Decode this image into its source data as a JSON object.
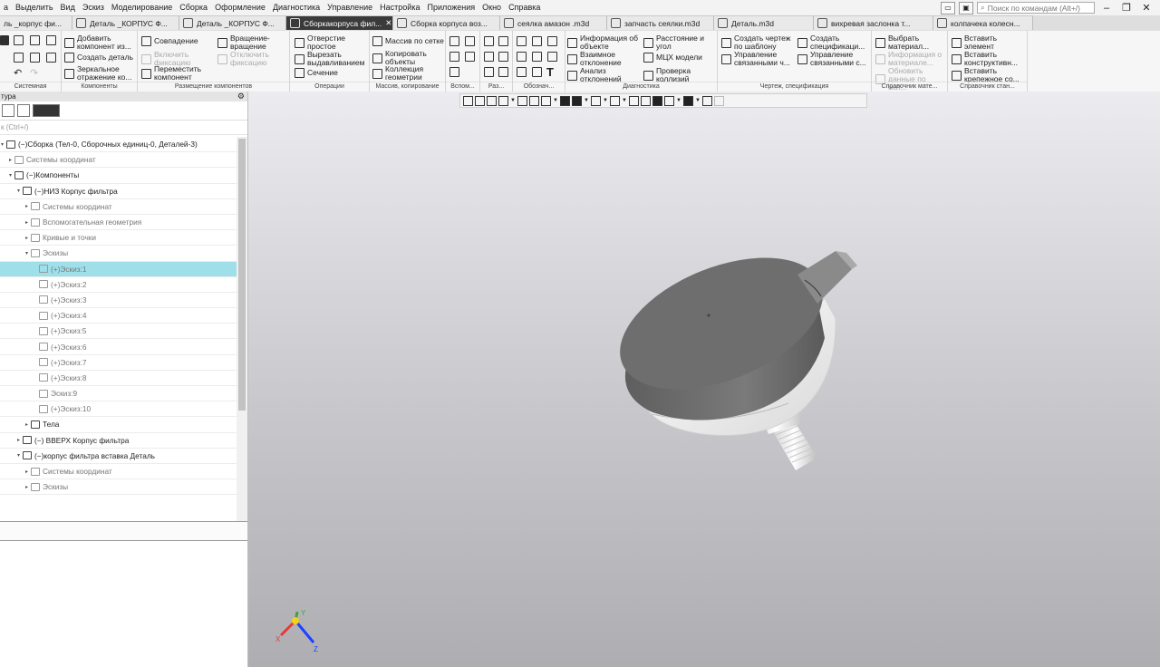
{
  "menubar": {
    "items": [
      "а",
      "Выделить",
      "Вид",
      "Эскиз",
      "Моделирование",
      "Сборка",
      "Оформление",
      "Диагностика",
      "Управление",
      "Настройка",
      "Приложения",
      "Окно",
      "Справка"
    ],
    "search_placeholder": "Поиск по командам (Alt+/)"
  },
  "tabs": [
    {
      "label": "ль _корпус фи...",
      "active": false
    },
    {
      "label": "Деталь _КОРПУС Ф...",
      "active": false
    },
    {
      "label": "Деталь _КОРПУС Ф...",
      "active": false
    },
    {
      "label": "Сборкакорпуса фил...",
      "active": true
    },
    {
      "label": "Сборка корпуса воз...",
      "active": false
    },
    {
      "label": "сеялка амазон .m3d",
      "active": false
    },
    {
      "label": "запчасть сеялки.m3d",
      "active": false
    },
    {
      "label": "Деталь.m3d",
      "active": false
    },
    {
      "label": "вихревая заслонка т...",
      "active": false
    },
    {
      "label": "колпачека колесн...",
      "active": false
    }
  ],
  "ribbon": {
    "groups": [
      {
        "title": "Системная"
      },
      {
        "title": "Компоненты"
      },
      {
        "title": "Размещение компонентов"
      },
      {
        "title": "Операции"
      },
      {
        "title": "Массив, копирование"
      },
      {
        "title": "Вспом..."
      },
      {
        "title": "Раз..."
      },
      {
        "title": "Обознач..."
      },
      {
        "title": "Диагностика"
      },
      {
        "title": "Чертеж, спецификация"
      },
      {
        "title": "Справочник мате..."
      },
      {
        "title": "Справочник стан..."
      }
    ],
    "components": {
      "add_component": "Добавить компонент из...",
      "create_part": "Создать деталь",
      "mirror": "Зеркальное отражение ко..."
    },
    "placement": {
      "coincidence": "Совпадение",
      "rotation": "Вращение-вращение",
      "enable_fix": "Включить фиксацию",
      "disable_fix": "Отключить фиксацию",
      "move_component": "Переместить компонент"
    },
    "operations": {
      "hole": "Отверстие простое",
      "cut_extrude": "Вырезать выдавливанием",
      "section": "Сечение"
    },
    "pattern": {
      "grid_pattern": "Массив по сетке",
      "copy_objects": "Копировать объекты",
      "geometry_collection": "Коллекция геометрии"
    },
    "diagnostics": {
      "object_info": "Информация об объекте",
      "mutual_deviation": "Взаимное отклонение",
      "deviation_analysis": "Анализ отклонений",
      "distance_angle": "Расстояние и угол",
      "mcx_model": "МЦХ модели",
      "collision_check": "Проверка коллизий"
    },
    "drawing": {
      "create_drawing": "Создать чертеж по шаблону",
      "manage_linked": "Управление связанными ч...",
      "create_spec": "Создать спецификаци...",
      "manage_linked_spec": "Управление связанными с..."
    },
    "materials": {
      "choose_material": "Выбрать материал...",
      "material_info": "Информация о материале...",
      "update_data": "Обновить данные по мат..."
    },
    "standard": {
      "insert_element": "Вставить элемент",
      "insert_constructive": "Вставить конструктивн...",
      "insert_fastener": "Вставить крепежное со..."
    }
  },
  "panel": {
    "title": "тура",
    "filter_placeholder": "к (Ctrl+/)",
    "tree": [
      {
        "indent": 0,
        "label": "(−)Сборка (Тел-0, Сборочных единиц-0, Деталей-3)",
        "arrow": "▾",
        "grey": false,
        "selected": false
      },
      {
        "indent": 1,
        "label": "Системы координат",
        "arrow": "▸",
        "grey": true,
        "selected": false
      },
      {
        "indent": 1,
        "label": "(−)Компоненты",
        "arrow": "▾",
        "grey": false,
        "selected": false
      },
      {
        "indent": 2,
        "label": "(−)НИЗ Корпус фильтра",
        "arrow": "▾",
        "grey": false,
        "selected": false
      },
      {
        "indent": 3,
        "label": "Системы координат",
        "arrow": "▸",
        "grey": true,
        "selected": false
      },
      {
        "indent": 3,
        "label": "Вспомогательная геометрия",
        "arrow": "▸",
        "grey": true,
        "selected": false
      },
      {
        "indent": 3,
        "label": "Кривые и точки",
        "arrow": "▸",
        "grey": true,
        "selected": false
      },
      {
        "indent": 3,
        "label": "Эскизы",
        "arrow": "▾",
        "grey": true,
        "selected": false
      },
      {
        "indent": 4,
        "label": "(+)Эскиз:1",
        "arrow": "",
        "grey": true,
        "selected": true
      },
      {
        "indent": 4,
        "label": "(+)Эскиз:2",
        "arrow": "",
        "grey": true,
        "selected": false
      },
      {
        "indent": 4,
        "label": "(+)Эскиз:3",
        "arrow": "",
        "grey": true,
        "selected": false
      },
      {
        "indent": 4,
        "label": "(+)Эскиз:4",
        "arrow": "",
        "grey": true,
        "selected": false
      },
      {
        "indent": 4,
        "label": "(+)Эскиз:5",
        "arrow": "",
        "grey": true,
        "selected": false
      },
      {
        "indent": 4,
        "label": "(+)Эскиз:6",
        "arrow": "",
        "grey": true,
        "selected": false
      },
      {
        "indent": 4,
        "label": "(+)Эскиз:7",
        "arrow": "",
        "grey": true,
        "selected": false
      },
      {
        "indent": 4,
        "label": "(+)Эскиз:8",
        "arrow": "",
        "grey": true,
        "selected": false
      },
      {
        "indent": 4,
        "label": "Эскиз:9",
        "arrow": "",
        "grey": true,
        "selected": false
      },
      {
        "indent": 4,
        "label": "(+)Эскиз:10",
        "arrow": "",
        "grey": true,
        "selected": false
      },
      {
        "indent": 3,
        "label": "Тела",
        "arrow": "▸",
        "grey": false,
        "selected": false
      },
      {
        "indent": 2,
        "label": "(−) ВВЕРХ Корпус фильтра",
        "arrow": "▸",
        "grey": false,
        "selected": false
      },
      {
        "indent": 2,
        "label": "(−)корпус фильтра вставка Деталь",
        "arrow": "▾",
        "grey": false,
        "selected": false
      },
      {
        "indent": 3,
        "label": "Системы координат",
        "arrow": "▸",
        "grey": true,
        "selected": false
      },
      {
        "indent": 3,
        "label": "Эскизы",
        "arrow": "▸",
        "grey": true,
        "selected": false
      }
    ]
  },
  "triad": {
    "x_label": "X",
    "y_label": "Y",
    "z_label": "Z",
    "x_color": "#e53935",
    "y_color": "#43a047",
    "z_color": "#1e40ff",
    "origin_color": "#f2d21b"
  },
  "colors": {
    "selection": "#9fdfea",
    "active_tab": "#3a3a3a",
    "model_dark": "#6e6e6e",
    "model_light": "#f2f2f2"
  }
}
